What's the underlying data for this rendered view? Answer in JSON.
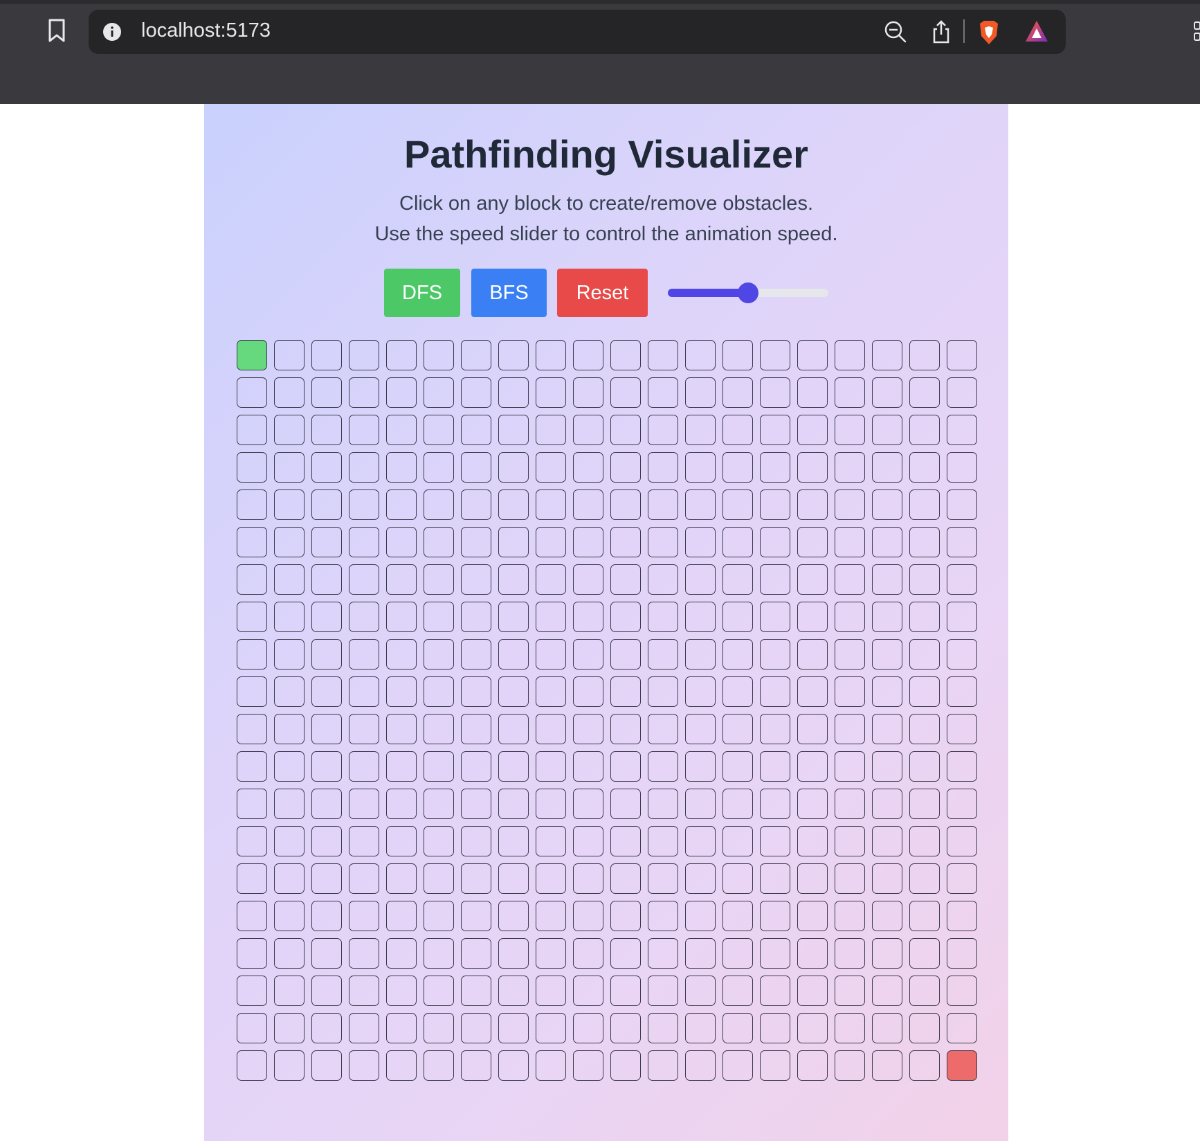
{
  "browser": {
    "url": "localhost:5173",
    "icons": [
      "bookmark-icon",
      "info-icon",
      "zoom-out-icon",
      "share-icon",
      "brave-shield-icon",
      "brave-rewards-icon"
    ]
  },
  "page": {
    "title": "Pathfinding Visualizer",
    "description_line1": "Click on any block to create/remove obstacles.",
    "description_line2": "Use the speed slider to control the animation speed."
  },
  "controls": {
    "dfs_label": "DFS",
    "bfs_label": "BFS",
    "reset_label": "Reset",
    "speed_slider_fraction": 0.5
  },
  "grid": {
    "rows": 20,
    "cols": 20,
    "start": [
      0,
      0
    ],
    "end": [
      19,
      19
    ],
    "start_color": "#66d97f",
    "end_color": "#ee6b6b"
  },
  "colors": {
    "dfs_button": "#4cc867",
    "bfs_button": "#3b7ff5",
    "reset_button": "#e84a4a",
    "slider_accent": "#4f46e5",
    "title_text": "#1f2937"
  }
}
